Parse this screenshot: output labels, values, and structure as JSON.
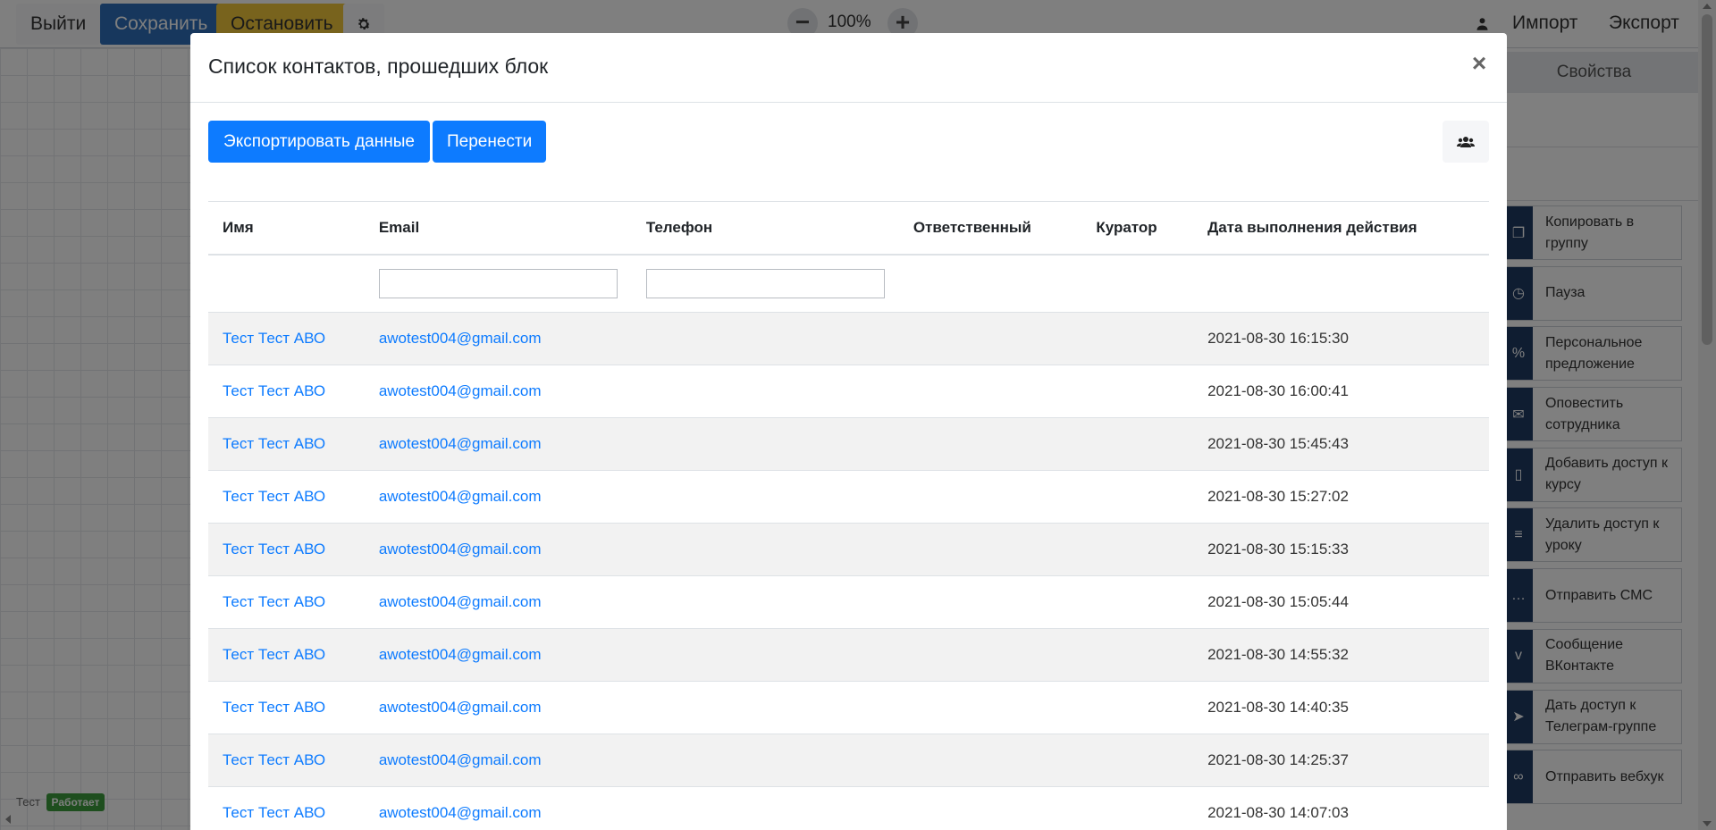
{
  "toolbar": {
    "exit_label": "Выйти",
    "save_label": "Сохранить",
    "stop_label": "Остановить",
    "zoom_level": "100%",
    "import_label": "Импорт",
    "export_label": "Экспорт"
  },
  "side_panel": {
    "properties_label": "Свойства",
    "actions": [
      {
        "label": "Копировать в группу",
        "icon": "copy-icon"
      },
      {
        "label": "Пауза",
        "icon": "clock-icon"
      },
      {
        "label": "Персональное предложение",
        "icon": "percent-icon"
      },
      {
        "label": "Оповестить сотрудника",
        "icon": "envelope-icon"
      },
      {
        "label": "Добавить доступ к курсу",
        "icon": "book-icon"
      },
      {
        "label": "Удалить доступ к уроку",
        "icon": "lesson-icon"
      },
      {
        "label": "Отправить СМС",
        "icon": "sms-icon"
      },
      {
        "label": "Сообщение ВКонтакте",
        "icon": "vk-icon"
      },
      {
        "label": "Дать доступ к Телеграм-группе",
        "icon": "telegram-icon"
      },
      {
        "label": "Отправить вебхук",
        "icon": "link-icon"
      }
    ]
  },
  "status": {
    "name": "Тест",
    "badge": "Работает"
  },
  "modal": {
    "title": "Список контактов, прошедших блок",
    "close_symbol": "×",
    "export_button": "Экспортировать данные",
    "move_button": "Перенести",
    "columns": [
      "Имя",
      "Email",
      "Телефон",
      "Ответственный",
      "Куратор",
      "Дата выполнения действия"
    ],
    "rows": [
      {
        "name": "Тест Тест АВО",
        "email": "awotest004@gmail.com",
        "phone": "",
        "responsible": "",
        "curator": "",
        "date": "2021-08-30 16:15:30"
      },
      {
        "name": "Тест Тест АВО",
        "email": "awotest004@gmail.com",
        "phone": "",
        "responsible": "",
        "curator": "",
        "date": "2021-08-30 16:00:41"
      },
      {
        "name": "Тест Тест АВО",
        "email": "awotest004@gmail.com",
        "phone": "",
        "responsible": "",
        "curator": "",
        "date": "2021-08-30 15:45:43"
      },
      {
        "name": "Тест Тест АВО",
        "email": "awotest004@gmail.com",
        "phone": "",
        "responsible": "",
        "curator": "",
        "date": "2021-08-30 15:27:02"
      },
      {
        "name": "Тест Тест АВО",
        "email": "awotest004@gmail.com",
        "phone": "",
        "responsible": "",
        "curator": "",
        "date": "2021-08-30 15:15:33"
      },
      {
        "name": "Тест Тест АВО",
        "email": "awotest004@gmail.com",
        "phone": "",
        "responsible": "",
        "curator": "",
        "date": "2021-08-30 15:05:44"
      },
      {
        "name": "Тест Тест АВО",
        "email": "awotest004@gmail.com",
        "phone": "",
        "responsible": "",
        "curator": "",
        "date": "2021-08-30 14:55:32"
      },
      {
        "name": "Тест Тест АВО",
        "email": "awotest004@gmail.com",
        "phone": "",
        "responsible": "",
        "curator": "",
        "date": "2021-08-30 14:40:35"
      },
      {
        "name": "Тест Тест АВО",
        "email": "awotest004@gmail.com",
        "phone": "",
        "responsible": "",
        "curator": "",
        "date": "2021-08-30 14:25:37"
      },
      {
        "name": "Тест Тест АВО",
        "email": "awotest004@gmail.com",
        "phone": "",
        "responsible": "",
        "curator": "",
        "date": "2021-08-30 14:07:03"
      }
    ]
  },
  "colors": {
    "primary": "#0d7bff",
    "save_button": "#2f6fba",
    "stop_button": "#f0c63a",
    "action_icon_bg": "#1e3a63",
    "status_badge": "#3d9c3d"
  }
}
